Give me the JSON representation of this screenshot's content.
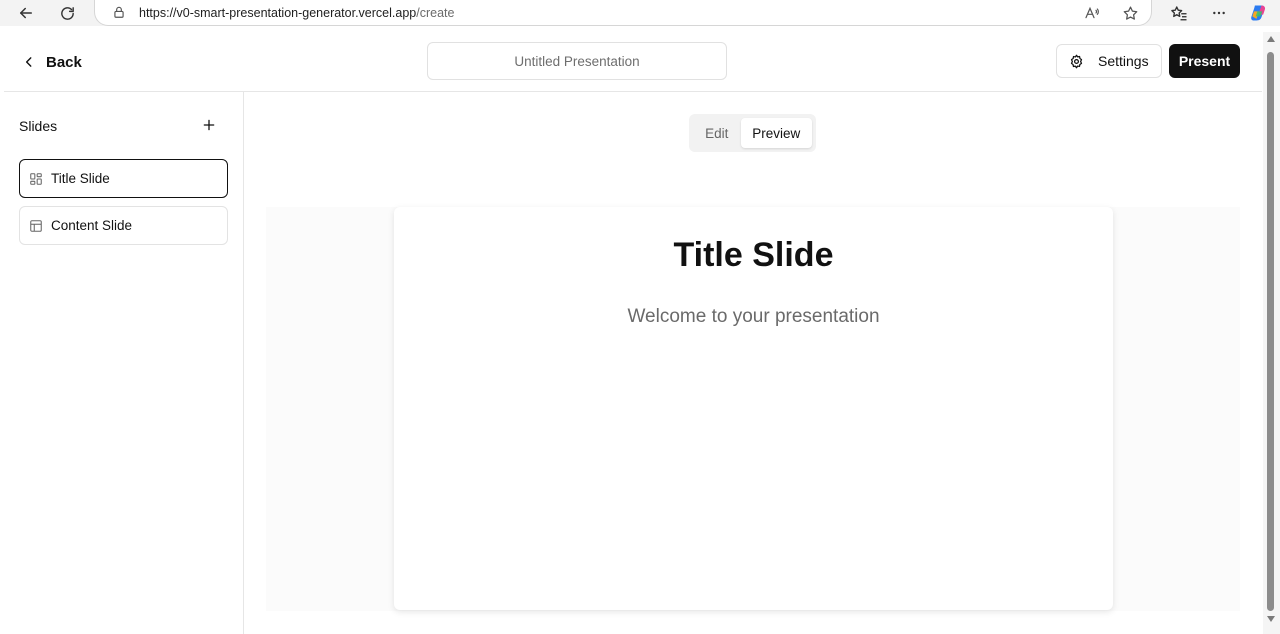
{
  "browser": {
    "url_host": "https://v0-smart-presentation-generator.vercel.app",
    "url_path": "/create"
  },
  "header": {
    "back_label": "Back",
    "title_placeholder": "Untitled Presentation",
    "title_value": "",
    "settings_label": "Settings",
    "present_label": "Present"
  },
  "sidebar": {
    "title": "Slides",
    "items": [
      {
        "label": "Title Slide",
        "icon": "layout-grid-icon",
        "active": true
      },
      {
        "label": "Content Slide",
        "icon": "layout-icon",
        "active": false
      }
    ]
  },
  "mode_toggle": {
    "edit_label": "Edit",
    "preview_label": "Preview",
    "selected": "Preview"
  },
  "slide": {
    "heading": "Title Slide",
    "subtitle": "Welcome to your presentation"
  },
  "colors": {
    "primary": "#111111",
    "border": "#e3e3e3",
    "muted_text": "#6a6a6a"
  }
}
